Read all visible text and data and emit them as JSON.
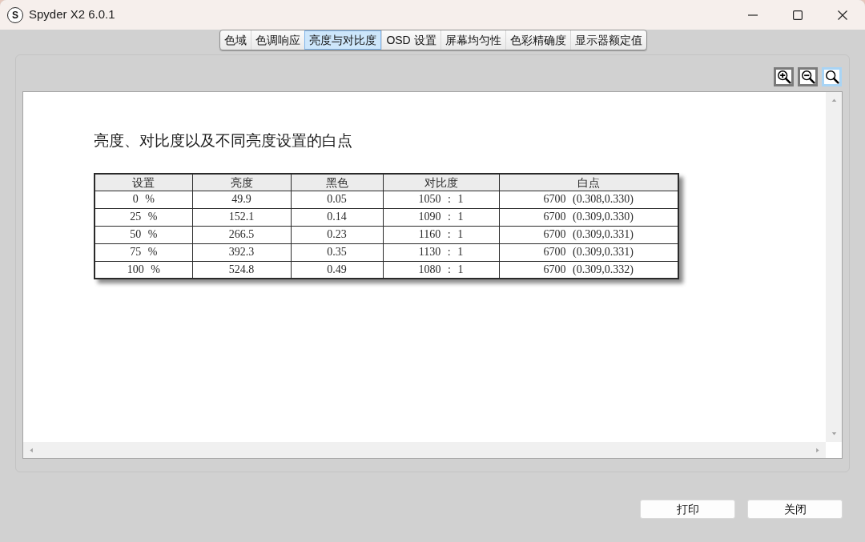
{
  "window": {
    "app_icon": "S",
    "title": "Spyder X2 6.0.1"
  },
  "tabs": [
    {
      "label": "色域",
      "selected": false
    },
    {
      "label": "色调响应",
      "selected": false
    },
    {
      "label": "亮度与对比度",
      "selected": true
    },
    {
      "label": "OSD 设置",
      "selected": false
    },
    {
      "label": "屏幕均匀性",
      "selected": false
    },
    {
      "label": "色彩精确度",
      "selected": false
    },
    {
      "label": "显示器额定值",
      "selected": false
    }
  ],
  "zoom_tools": [
    {
      "kind": "zoom_in",
      "selected": false
    },
    {
      "kind": "zoom_out",
      "selected": false
    },
    {
      "kind": "zoom_reset",
      "selected": true
    }
  ],
  "report": {
    "title": "亮度、对比度以及不同亮度设置的白点",
    "table": {
      "columns": [
        "设置",
        "亮度",
        "黑色",
        "对比度",
        "白点"
      ],
      "rows": [
        [
          "0 %",
          "49.9",
          "0.05",
          "1050 : 1",
          "6700 (0.308,0.330)"
        ],
        [
          "25 %",
          "152.1",
          "0.14",
          "1090 : 1",
          "6700 (0.309,0.330)"
        ],
        [
          "50 %",
          "266.5",
          "0.23",
          "1160 : 1",
          "6700 (0.309,0.331)"
        ],
        [
          "75 %",
          "392.3",
          "0.35",
          "1130 : 1",
          "6700 (0.309,0.331)"
        ],
        [
          "100 %",
          "524.8",
          "0.49",
          "1080 : 1",
          "6700 (0.309,0.332)"
        ]
      ]
    }
  },
  "buttons": [
    "打印",
    "关闭"
  ]
}
